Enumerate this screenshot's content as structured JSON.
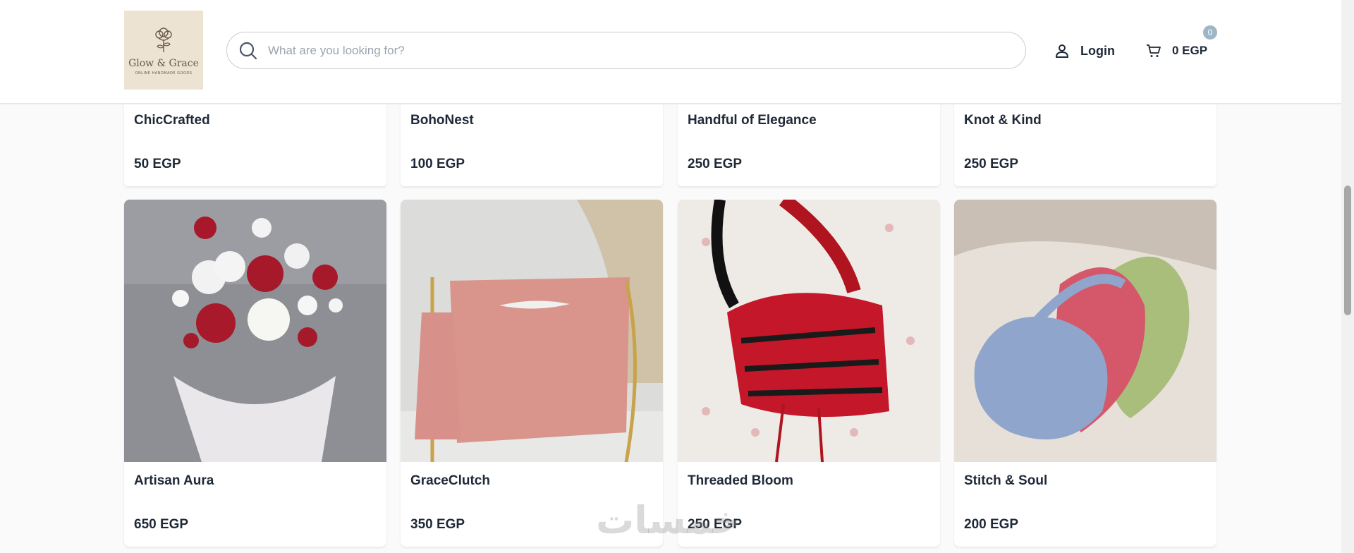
{
  "header": {
    "logo": {
      "name": "Glow & Grace",
      "tagline": "ONLINE HANDMADE GOODS"
    },
    "search": {
      "placeholder": "What are you looking for?"
    },
    "login_label": "Login",
    "cart": {
      "total": "0 EGP",
      "count": "0"
    }
  },
  "products_top": [
    {
      "title": "ChicCrafted",
      "price": "50 EGP"
    },
    {
      "title": "BohoNest",
      "price": "100 EGP"
    },
    {
      "title": "Handful of Elegance",
      "price": "250 EGP"
    },
    {
      "title": "Knot & Kind",
      "price": "250 EGP"
    }
  ],
  "products_bottom": [
    {
      "title": "Artisan Aura",
      "price": "650 EGP",
      "image": "crochet-flower-bouquet"
    },
    {
      "title": "GraceClutch",
      "price": "350 EGP",
      "image": "pink-crochet-clutch"
    },
    {
      "title": "Threaded Bloom",
      "price": "250 EGP",
      "image": "red-black-crochet-bag"
    },
    {
      "title": "Stitch & Soul",
      "price": "200 EGP",
      "image": "crochet-hobo-bags"
    }
  ],
  "watermark": "خمسات",
  "colors": {
    "logo_bg": "#ede3d2",
    "badge": "#9fb6c8",
    "text": "#1f2937"
  }
}
